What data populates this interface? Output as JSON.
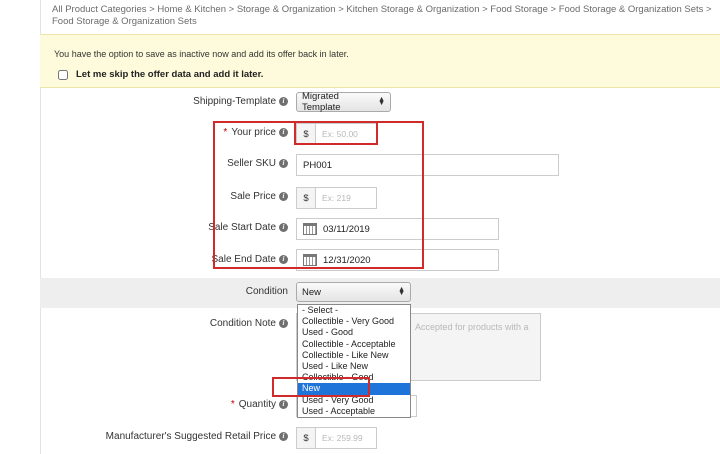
{
  "breadcrumb": "All Product Categories > Home & Kitchen > Storage & Organization > Kitchen Storage & Organization > Food Storage > Food Storage & Organization Sets > Food Storage & Organization Sets",
  "notice": {
    "text": "You have the option to save as inactive now and add its offer back in later.",
    "checkbox_label": "Let me skip the offer data and add it later."
  },
  "fields": {
    "shipping_template": {
      "label": "Shipping-Template",
      "value": "Migrated Template"
    },
    "your_price": {
      "label": "Your price",
      "prefix": "$",
      "placeholder": "Ex: 50.00",
      "required": "*"
    },
    "seller_sku": {
      "label": "Seller SKU",
      "value": "PH001"
    },
    "sale_price": {
      "label": "Sale Price",
      "prefix": "$",
      "placeholder": "Ex: 219"
    },
    "sale_start_date": {
      "label": "Sale Start Date",
      "value": "03/11/2019"
    },
    "sale_end_date": {
      "label": "Sale End Date",
      "value": "12/31/2020"
    },
    "condition": {
      "label": "Condition",
      "value": "New"
    },
    "condition_note": {
      "label": "Condition Note",
      "placeholder": "Accepted for products with a"
    },
    "quantity": {
      "label": "Quantity",
      "required": "*"
    },
    "msrp": {
      "label": "Manufacturer's Suggested Retail Price",
      "prefix": "$",
      "placeholder": "Ex: 259.99"
    }
  },
  "condition_options": [
    "- Select -",
    "Collectible - Very Good",
    "Used - Good",
    "Collectible - Acceptable",
    "Collectible - Like New",
    "Used - Like New",
    "Collectible - Good",
    "New",
    "Used - Very Good",
    "Used - Acceptable"
  ],
  "selected_option": "New",
  "annotation_color": "#d12a2a",
  "highlight_color": "#1e74d8",
  "notice_bg": "#fdfbdb"
}
